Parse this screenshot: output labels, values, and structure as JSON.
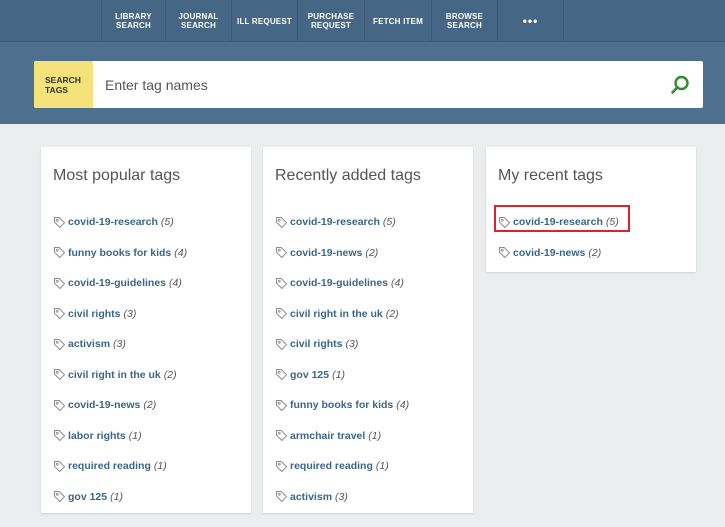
{
  "nav": {
    "items": [
      {
        "label": "LIBRARY\nSEARCH"
      },
      {
        "label": "JOURNAL\nSEARCH"
      },
      {
        "label": "ILL REQUEST"
      },
      {
        "label": "PURCHASE\nREQUEST"
      },
      {
        "label": "FETCH ITEM"
      },
      {
        "label": "BROWSE\nSEARCH"
      },
      {
        "label": "•••"
      }
    ]
  },
  "search": {
    "label": "SEARCH\nTAGS",
    "placeholder": "Enter tag names",
    "icon": "search-icon"
  },
  "popular": {
    "title": "Most popular tags",
    "tags": [
      {
        "name": "covid-19-research",
        "count": "(5)"
      },
      {
        "name": "funny books for kids",
        "count": "(4)"
      },
      {
        "name": "covid-19-guidelines",
        "count": "(4)"
      },
      {
        "name": "civil rights",
        "count": "(3)"
      },
      {
        "name": "activism",
        "count": "(3)"
      },
      {
        "name": "civil right in the uk",
        "count": "(2)"
      },
      {
        "name": "covid-19-news",
        "count": "(2)"
      },
      {
        "name": "labor rights",
        "count": "(1)"
      },
      {
        "name": "required reading",
        "count": "(1)"
      },
      {
        "name": "gov 125",
        "count": "(1)"
      }
    ]
  },
  "recent_added": {
    "title": "Recently added tags",
    "tags": [
      {
        "name": "covid-19-research",
        "count": "(5)"
      },
      {
        "name": "covid-19-news",
        "count": "(2)"
      },
      {
        "name": "covid-19-guidelines",
        "count": "(4)"
      },
      {
        "name": "civil right in the uk",
        "count": "(2)"
      },
      {
        "name": "civil rights",
        "count": "(3)"
      },
      {
        "name": "gov 125",
        "count": "(1)"
      },
      {
        "name": "funny books for kids",
        "count": "(4)"
      },
      {
        "name": "armchair travel",
        "count": "(1)"
      },
      {
        "name": "required reading",
        "count": "(1)"
      },
      {
        "name": "activism",
        "count": "(3)"
      }
    ]
  },
  "my_recent": {
    "title": "My recent tags",
    "tags": [
      {
        "name": "covid-19-research",
        "count": "(5)"
      },
      {
        "name": "covid-19-news",
        "count": "(2)"
      }
    ]
  },
  "colors": {
    "header": "#4e6f8e",
    "nav": "#456684",
    "search_label_bg": "#f6e27b",
    "search_icon": "#2e8b2e",
    "tag_link": "#3a6689",
    "highlight": "#d9232e"
  }
}
